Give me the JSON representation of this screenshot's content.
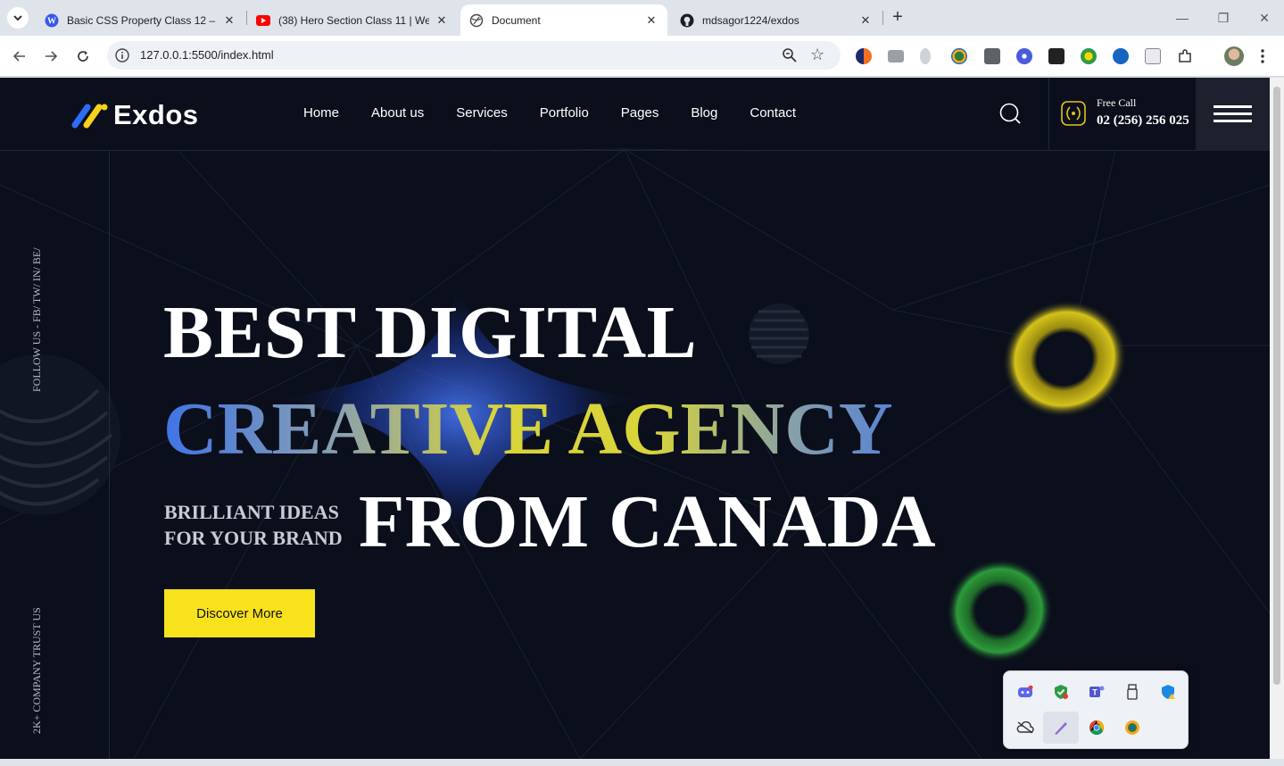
{
  "browser": {
    "tabs": [
      {
        "title": "Basic CSS Property Class 12 – W",
        "icon": "wordpress-icon",
        "active": false
      },
      {
        "title": "(38) Hero Section Class 11 | We",
        "icon": "youtube-icon",
        "active": false
      },
      {
        "title": "Document",
        "icon": "globe-icon",
        "active": true
      },
      {
        "title": "mdsagor1224/exdos",
        "icon": "github-icon",
        "active": false
      }
    ],
    "url": "127.0.0.1:5500/index.html"
  },
  "site": {
    "logo_text": "Exdos",
    "nav": [
      "Home",
      "About us",
      "Services",
      "Portfolio",
      "Pages",
      "Blog",
      "Contact"
    ],
    "call": {
      "label": "Free Call",
      "number": "02 (256) 256 025"
    },
    "side": {
      "follow": "FOLLOW US - FB/ TW/ IN/ BE/",
      "trust": "2K+ COMPANY TRUST US"
    },
    "hero": {
      "line1": "BEST DIGITAL",
      "line2": "CREATIVE AGENCY",
      "tagline1": "BRILLIANT IDEAS",
      "tagline2": "FOR YOUR BRAND",
      "line3": "FROM CANADA",
      "cta": "Discover More"
    },
    "colors": {
      "accent_yellow": "#f7e21b",
      "background": "#0b0f1c",
      "gradient_blue": "#3f74e6",
      "gradient_yellow": "#d8d43a"
    }
  },
  "tray_icons": [
    "discord-icon",
    "security-shield-check-icon",
    "teams-icon",
    "usb-drive-icon",
    "defender-warning-icon",
    "onedrive-offline-icon",
    "pen-icon",
    "chrome-icon",
    "network-globe-icon"
  ]
}
